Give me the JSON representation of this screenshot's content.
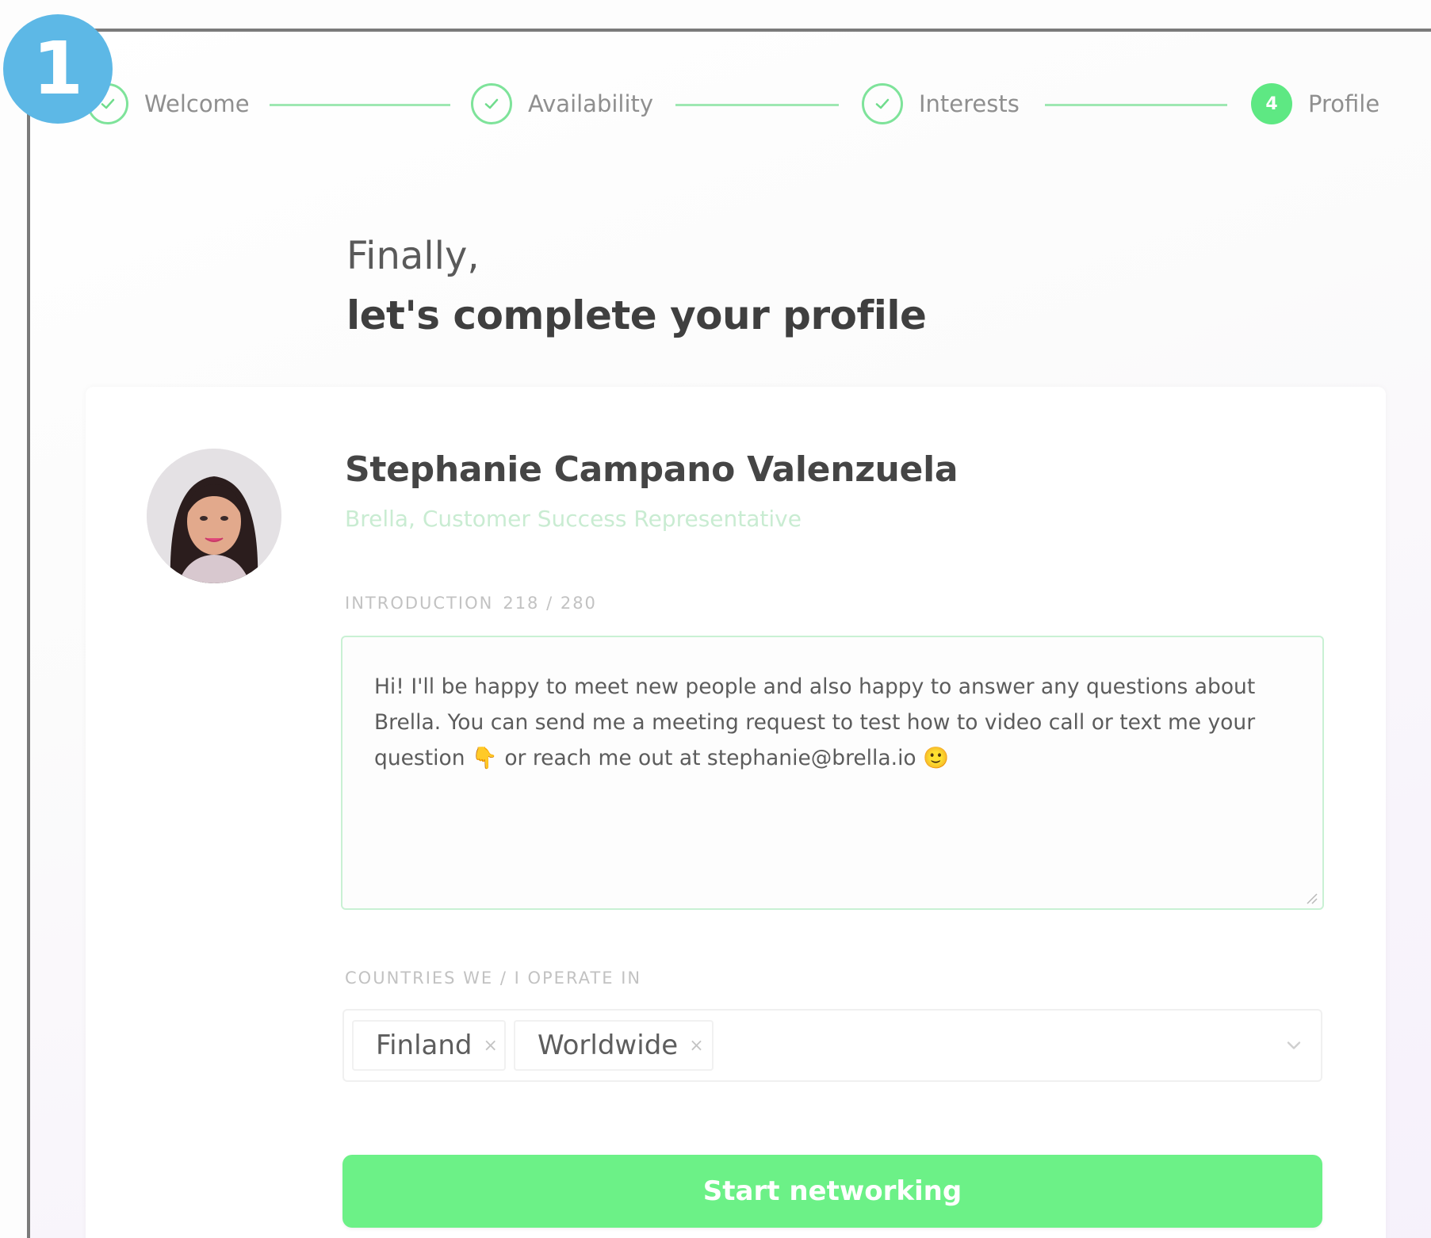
{
  "badge": {
    "number": "1",
    "color": "#5db8e6"
  },
  "stepper": {
    "steps": [
      {
        "label": "Welcome",
        "state": "done"
      },
      {
        "label": "Availability",
        "state": "done"
      },
      {
        "label": "Interests",
        "state": "done"
      },
      {
        "label": "Profile",
        "state": "active",
        "number": "4"
      }
    ],
    "accent_color": "#5ee883"
  },
  "headline": {
    "line1": "Finally,",
    "line2": "let's complete your profile"
  },
  "profile": {
    "name": "Stephanie Campano Valenzuela",
    "role": "Brella, Customer Success Representative",
    "avatar_icon": "user-photo"
  },
  "introduction": {
    "label": "INTRODUCTION",
    "count": "218 / 280",
    "value": "Hi! I'll be happy to meet new people and also happy to answer any questions about Brella. You can send me a meeting request to test how to video call or text me your question 👇 or reach me out at stephanie@brella.io 🙂"
  },
  "countries": {
    "label": "COUNTRIES WE / I OPERATE IN",
    "selected": [
      {
        "label": "Finland",
        "remove": "×"
      },
      {
        "label": "Worldwide",
        "remove": "×"
      }
    ],
    "dropdown_icon": "chevron-down-icon"
  },
  "actions": {
    "start_label": "Start networking",
    "button_color": "#6cf187"
  }
}
